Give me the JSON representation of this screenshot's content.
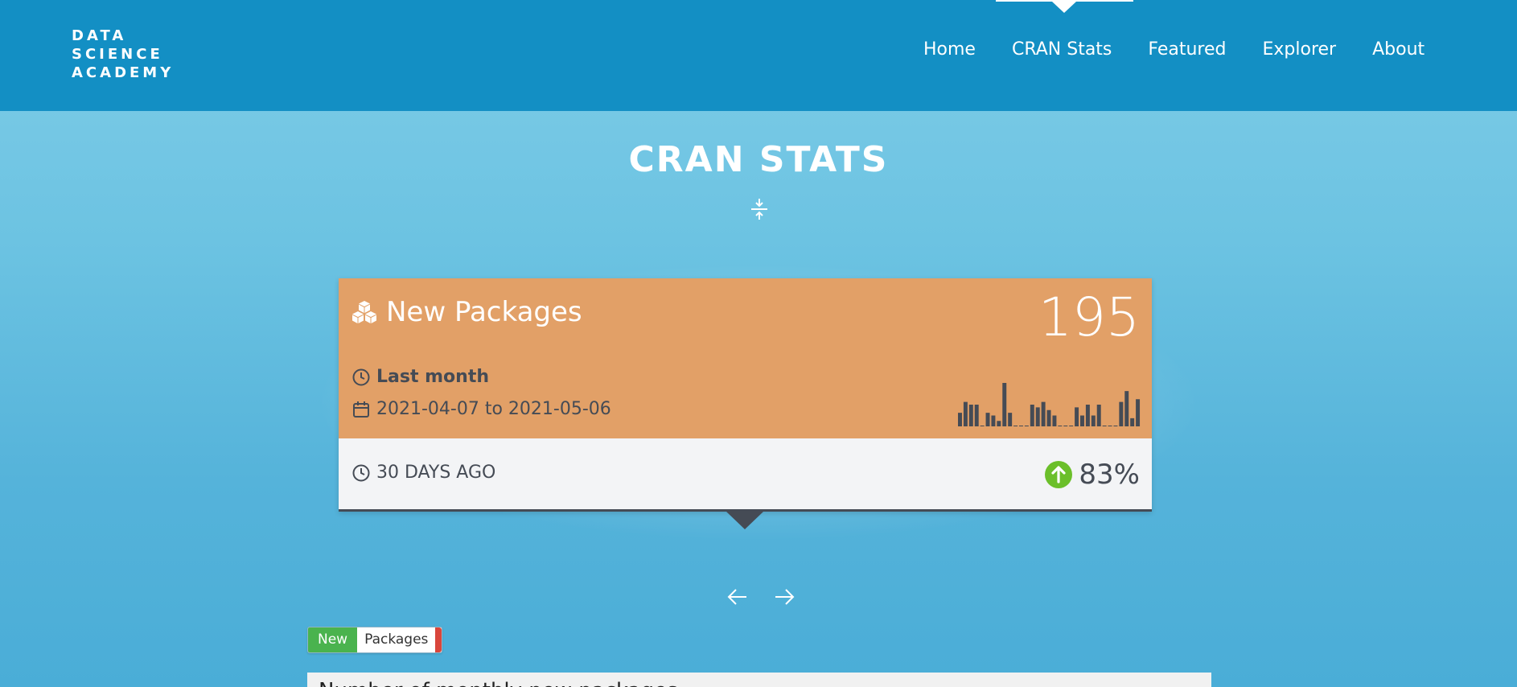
{
  "header": {
    "logo_lines": [
      "DATA",
      "SCIENCE",
      "ACADEMY"
    ],
    "nav": [
      {
        "label": "Home",
        "active": false
      },
      {
        "label": "CRAN Stats",
        "active": true
      },
      {
        "label": "Featured",
        "active": false
      },
      {
        "label": "Explorer",
        "active": false
      },
      {
        "label": "About",
        "active": false
      }
    ]
  },
  "page": {
    "title": "CRAN STATS",
    "collapse_icon": "compress-icon"
  },
  "card": {
    "icon": "cubes-icon",
    "title": "New Packages",
    "value": "195",
    "period_label": "Last month",
    "period_icon": "clock-icon",
    "date_range": "2021-04-07 to 2021-05-06",
    "date_icon": "calendar-icon",
    "ago_label": "30 DAYS AGO",
    "ago_icon": "clock-icon",
    "change_icon": "arrow-up-circle-icon",
    "change_value": "83%",
    "colors": {
      "top": "#e2a067",
      "bottom": "#f3f4f6",
      "text_dark": "#454b55",
      "change_up": "#6bbf2a"
    },
    "sparkline": [
      5,
      9,
      8,
      8,
      0,
      5,
      4,
      2,
      16,
      5,
      0,
      0,
      0,
      8,
      7,
      9,
      6,
      4,
      0,
      0,
      0,
      7,
      4,
      8,
      4,
      8,
      0,
      0,
      0,
      9,
      13,
      3,
      10
    ]
  },
  "carousel": {
    "prev_icon": "arrow-left-icon",
    "next_icon": "arrow-right-icon"
  },
  "tabs": {
    "new_label": "New",
    "packages_label": "Packages"
  },
  "panel": {
    "heading": "Number of monthly new packages"
  }
}
